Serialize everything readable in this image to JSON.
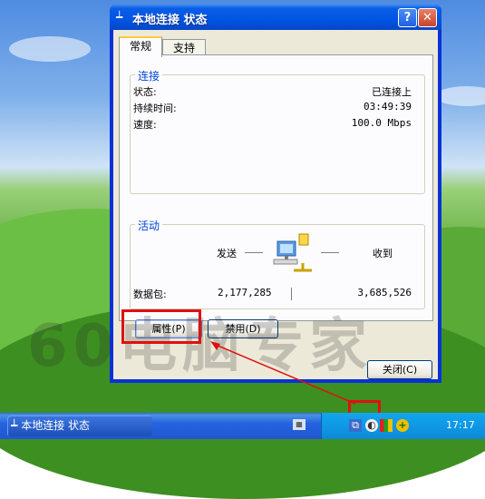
{
  "window": {
    "title": "本地连接 状态",
    "help_label": "?",
    "close_label": "✕"
  },
  "tabs": {
    "general": "常规",
    "support": "支持"
  },
  "connection": {
    "legend": "连接",
    "status_label": "状态:",
    "status_value": "已连接上",
    "duration_label": "持续时间:",
    "duration_value": "03:49:39",
    "speed_label": "速度:",
    "speed_value": "100.0 Mbps"
  },
  "activity": {
    "legend": "活动",
    "sent_label": "发送",
    "received_label": "收到",
    "packets_label": "数据包:",
    "packets_sent": "2,177,285",
    "packets_received": "3,685,526"
  },
  "buttons": {
    "properties": "属性(P)",
    "disable": "禁用(D)",
    "close": "关闭(C)"
  },
  "watermark": "60电脑专家",
  "taskbar": {
    "task_label": "本地连接 状态",
    "clock": "17:17"
  },
  "icons": [
    "network-connection-icon",
    "help-icon",
    "close-icon",
    "network-activity-icon",
    "keyboard-icon",
    "tray-network-icon",
    "tray-volume-icon",
    "tray-security-icon",
    "tray-update-icon"
  ],
  "colors": {
    "titlebar": "#0054e3",
    "legend": "#0046d5",
    "annotation": "#e01010"
  }
}
